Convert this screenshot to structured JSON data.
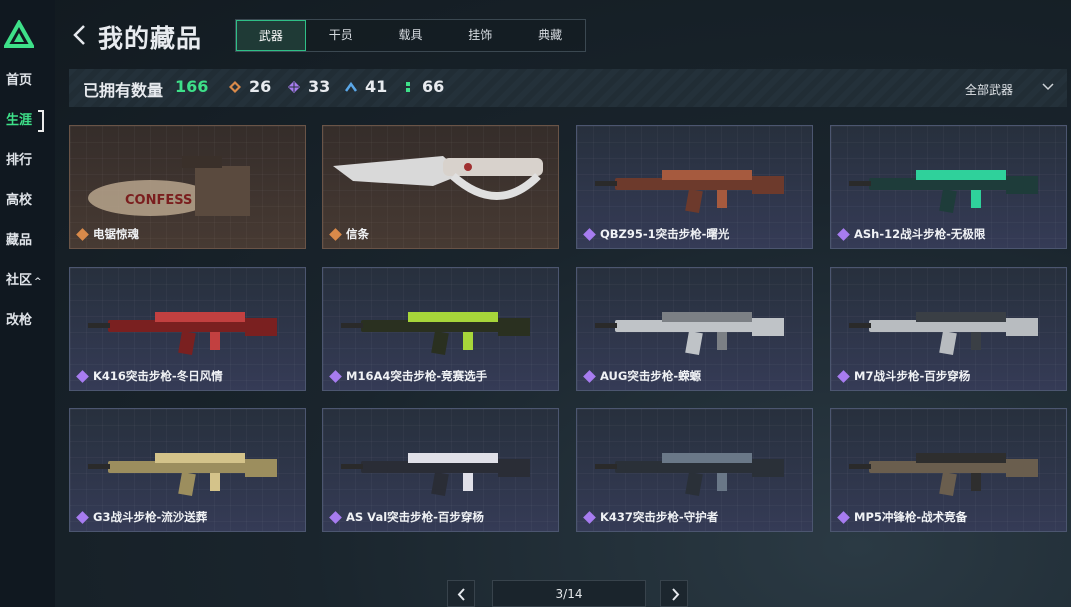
{
  "sidebar": {
    "items": [
      {
        "label": "首页",
        "active": false
      },
      {
        "label": "生涯",
        "active": true
      },
      {
        "label": "排行",
        "active": false
      },
      {
        "label": "高校",
        "active": false
      },
      {
        "label": "藏品",
        "active": false
      },
      {
        "label": "社区",
        "active": false,
        "caret": "^"
      },
      {
        "label": "改枪",
        "active": false
      }
    ],
    "logo_icon": "game-logo-icon"
  },
  "header": {
    "title": "我的藏品",
    "back_icon": "chevron-left-icon",
    "tabs": [
      {
        "label": "武器",
        "active": true
      },
      {
        "label": "干员",
        "active": false
      },
      {
        "label": "载具",
        "active": false
      },
      {
        "label": "挂饰",
        "active": false
      },
      {
        "label": "典藏",
        "active": false
      }
    ]
  },
  "stats": {
    "owned_label": "已拥有数量",
    "owned_count": "166",
    "rarity_counts": [
      {
        "rarity": "legendary",
        "color": "#d98a4a",
        "count": "26"
      },
      {
        "rarity": "epic",
        "color": "#a77cf0",
        "count": "33"
      },
      {
        "rarity": "rare",
        "color": "#5aa7e8",
        "count": "41"
      },
      {
        "rarity": "uncommon",
        "color": "#3ee089",
        "count": "66"
      }
    ],
    "filter_label": "全部武器",
    "filter_icon": "chevron-down-icon"
  },
  "colors": {
    "accent": "#3ee089",
    "legendary": "#d98a4a",
    "epic": "#a77cf0"
  },
  "items": [
    {
      "name": "电锯惊魂",
      "rarity": "legendary"
    },
    {
      "name": "信条",
      "rarity": "legendary"
    },
    {
      "name": "QBZ95-1突击步枪-曙光",
      "rarity": "epic"
    },
    {
      "name": "ASh-12战斗步枪-无极限",
      "rarity": "epic"
    },
    {
      "name": "K416突击步枪-冬日风情",
      "rarity": "epic"
    },
    {
      "name": "M16A4突击步枪-竞赛选手",
      "rarity": "epic"
    },
    {
      "name": "AUG突击步枪-蝾螈",
      "rarity": "epic"
    },
    {
      "name": "M7战斗步枪-百步穿杨",
      "rarity": "epic"
    },
    {
      "name": "G3战斗步枪-流沙送葬",
      "rarity": "epic"
    },
    {
      "name": "AS Val突击步枪-百步穿杨",
      "rarity": "epic"
    },
    {
      "name": "K437突击步枪-守护者",
      "rarity": "epic"
    },
    {
      "name": "MP5冲锋枪-战术竞备",
      "rarity": "epic"
    }
  ],
  "pagination": {
    "page_text": "3/14",
    "prev_icon": "chevron-left-icon",
    "next_icon": "chevron-right-icon"
  }
}
